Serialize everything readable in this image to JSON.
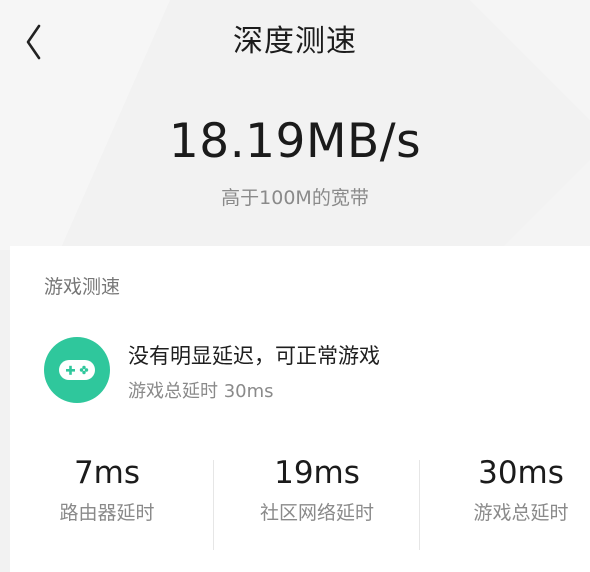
{
  "header": {
    "back_icon": "chevron-left-icon",
    "title": "深度测速"
  },
  "speed": {
    "value": "18.19MB/s",
    "description": "高于100M的宽带"
  },
  "game_test": {
    "label": "游戏测速",
    "icon": "gamepad-icon",
    "icon_color": "#2fc79c",
    "result_title": "没有明显延迟，可正常游戏",
    "result_subtitle": "游戏总延时 30ms",
    "stats": [
      {
        "value": "7ms",
        "label": "路由器延时"
      },
      {
        "value": "19ms",
        "label": "社区网络延时"
      },
      {
        "value": "30ms",
        "label": "游戏总延时"
      }
    ]
  }
}
